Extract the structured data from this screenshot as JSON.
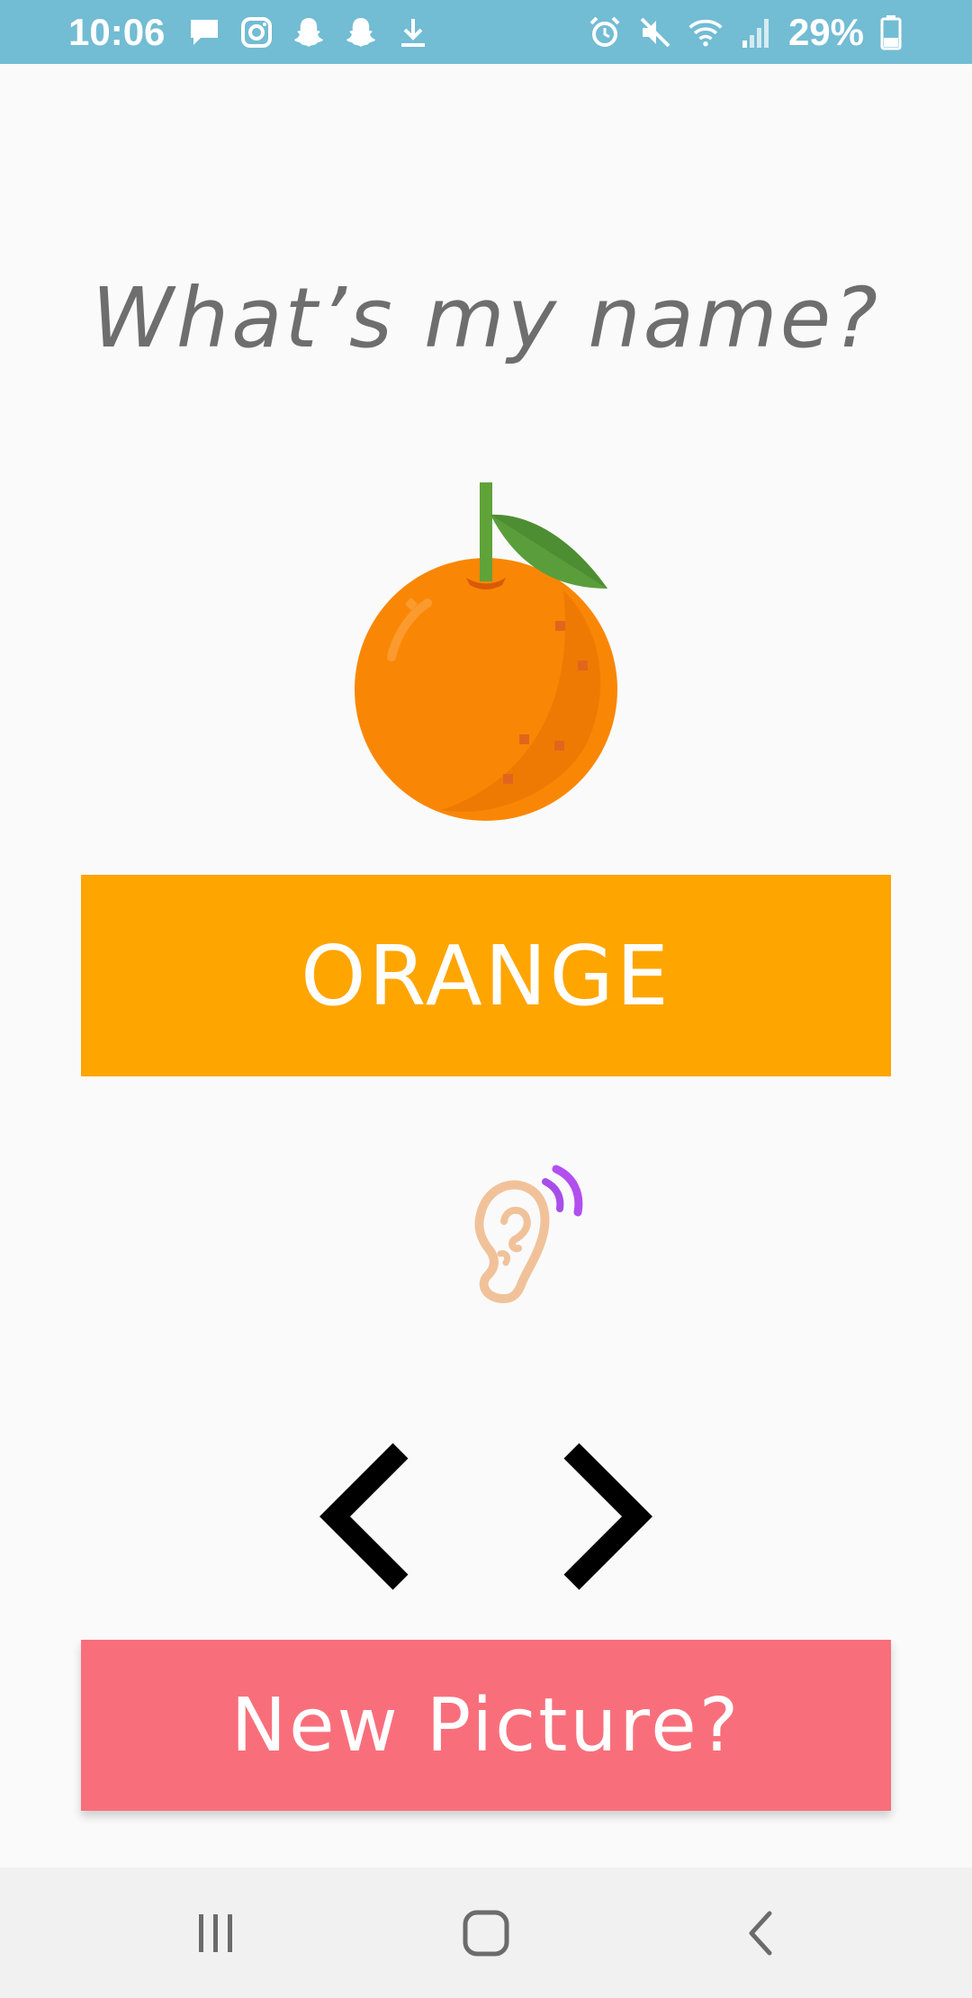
{
  "status_bar": {
    "time": "10:06",
    "battery": "29%",
    "background_color": "#72bcd4",
    "left_icons": [
      "message-icon",
      "instagram-icon",
      "snapchat-icon",
      "snapchat-icon",
      "download-icon"
    ],
    "right_icons": [
      "alarm-icon",
      "mute-icon",
      "wifi-icon",
      "signal-icon",
      "battery-icon"
    ]
  },
  "main": {
    "title": "What’s my name?",
    "fruit_icon": "orange-fruit-icon",
    "name_button_label": "ORANGE",
    "name_button_color": "#ffa500",
    "listen_icon": "ear-sound-icon",
    "prev_icon": "chevron-left-icon",
    "next_icon": "chevron-right-icon",
    "new_picture_label": "New Picture?",
    "new_picture_color": "#f86f7b"
  },
  "nav_bar": {
    "icons": [
      "recent-apps-icon",
      "home-icon",
      "back-icon"
    ]
  }
}
